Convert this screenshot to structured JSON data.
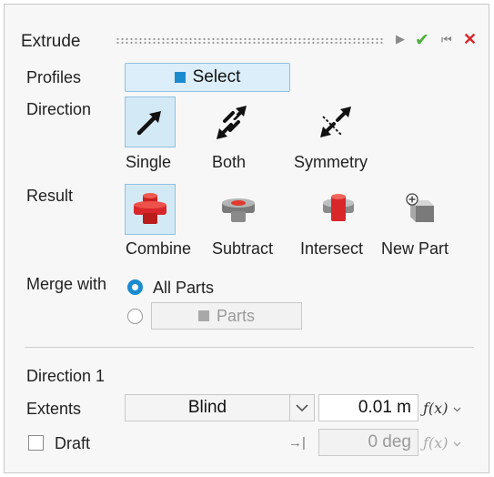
{
  "header": {
    "title": "Extrude",
    "play_glyph": "▶",
    "ok_glyph": "✔",
    "back_glyph": "⏮",
    "close_glyph": "✕"
  },
  "profiles": {
    "label": "Profiles",
    "select_label": "Select",
    "select_color": "#1b8bd0"
  },
  "direction": {
    "label": "Direction",
    "options": [
      {
        "label": "Single",
        "icon": "single-arrow-icon",
        "active": true
      },
      {
        "label": "Both",
        "icon": "double-arrow-icon",
        "active": false
      },
      {
        "label": "Symmetry",
        "icon": "symmetry-arrow-icon",
        "active": false
      }
    ]
  },
  "result": {
    "label": "Result",
    "options": [
      {
        "label": "Combine",
        "icon": "combine-icon",
        "active": true
      },
      {
        "label": "Subtract",
        "icon": "subtract-icon",
        "active": false
      },
      {
        "label": "Intersect",
        "icon": "intersect-icon",
        "active": false
      },
      {
        "label": "New Part",
        "icon": "new-part-icon",
        "active": false
      }
    ]
  },
  "merge": {
    "label": "Merge with",
    "all_parts_label": "All Parts",
    "parts_label": "Parts",
    "selected": "All Parts"
  },
  "direction1": {
    "title": "Direction 1",
    "extents_label": "Extents",
    "extents_value": "Blind",
    "distance_value": "0.01 m",
    "fx_label": "ƒ(x)",
    "draft_label": "Draft",
    "draft_checked": false,
    "draft_value": "0 deg",
    "draft_end_glyph": "→|"
  },
  "colors": {
    "accent": "#1b8bd0",
    "active_bg": "#d4e9f6",
    "ok_green": "#4caf3a",
    "close_red": "#d8262b",
    "solid_red": "#d8262b"
  }
}
